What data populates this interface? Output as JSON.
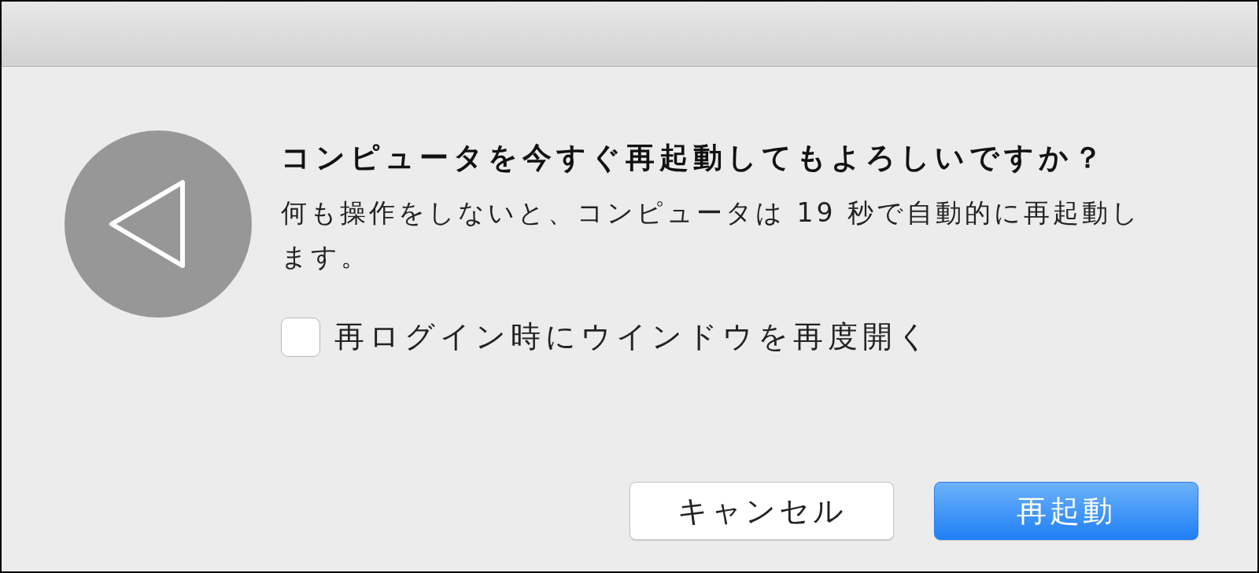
{
  "dialog": {
    "title": "コンピュータを今すぐ再起動してもよろしいですか？",
    "message": "何も操作をしないと、コンピュータは 19 秒で自動的に再起動します。",
    "checkbox": {
      "label": "再ログイン時にウインドウを再度開く",
      "checked": false
    },
    "buttons": [
      {
        "label": "キャンセル",
        "kind": "secondary"
      },
      {
        "label": "再起動",
        "kind": "primary"
      }
    ]
  }
}
